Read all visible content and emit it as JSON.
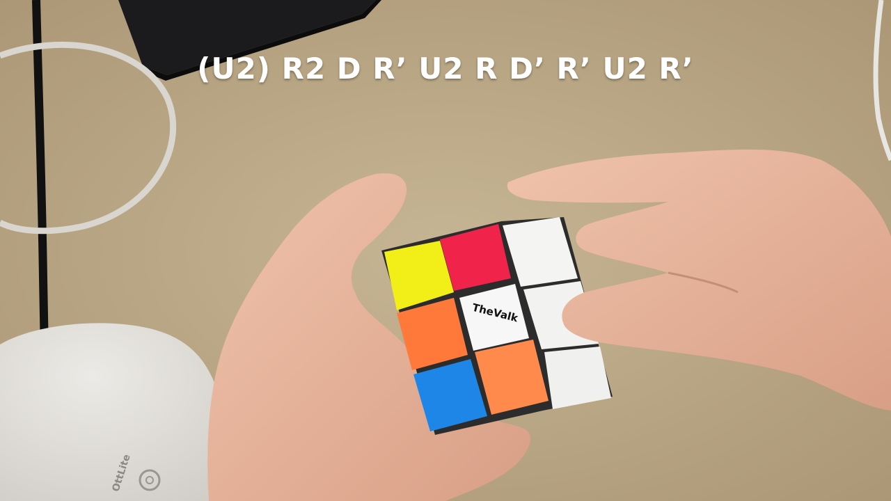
{
  "caption": {
    "text": "(U2) R2 D R’ U2 R D’ R’ U2 R’"
  },
  "cube": {
    "logo_text": "TheValk",
    "colors": {
      "yellow": "#f2ee18",
      "red": "#f0234a",
      "white": "#f4f4f2",
      "orange": "#ff7a3a",
      "blue": "#1e86e6",
      "peach": "#ff8a4c"
    }
  },
  "lamp": {
    "brand_text": "OttLite"
  },
  "colors": {
    "desk": "#b9a686",
    "skin": "#e8b79e",
    "laptop": "#1b1b1d"
  }
}
